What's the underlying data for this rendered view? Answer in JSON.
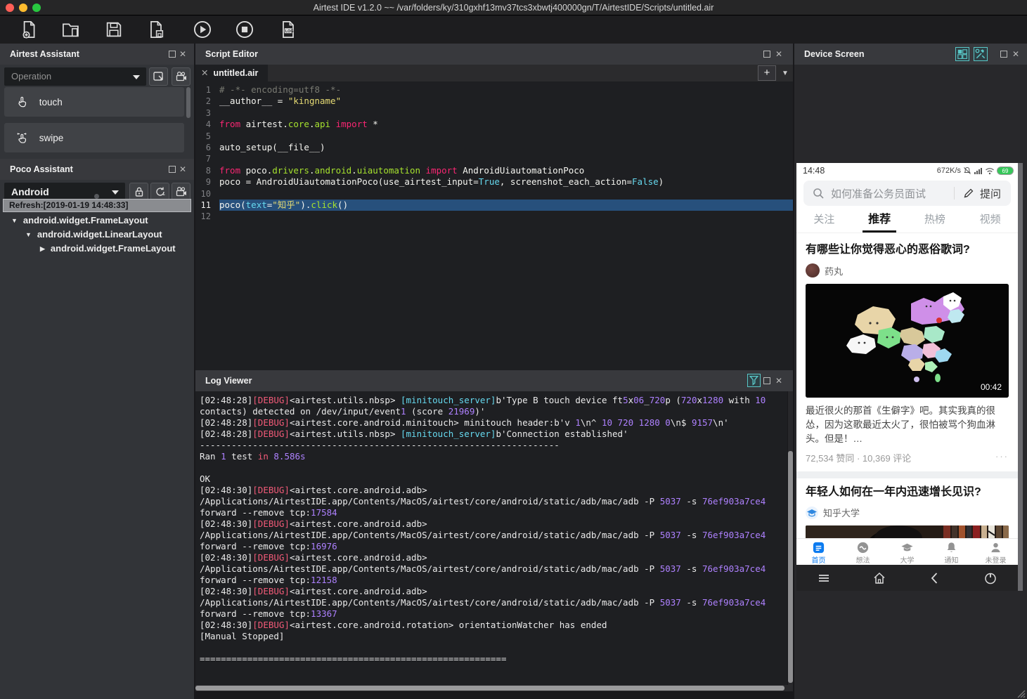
{
  "window": {
    "title": "Airtest IDE v1.2.0 ~~ /var/folders/ky/310gxhf13mv37tcs3xbwtj400000gn/T/AirtestIDE/Scripts/untitled.air"
  },
  "colors": {
    "accent_cyan": "#59c6c6",
    "highlight_line": "#27507c",
    "zhihu_blue": "#0c7bf0",
    "battery_green": "#35c759"
  },
  "toolbar": {
    "buttons": [
      "new-script",
      "open-script",
      "save-script",
      "save-script-as",
      "run-script",
      "stop-script",
      "view-log"
    ]
  },
  "airtest": {
    "title": "Airtest Assistant",
    "dropdown_value": "Operation",
    "actions": [
      {
        "label": "touch"
      },
      {
        "label": "swipe"
      }
    ]
  },
  "poco": {
    "title": "Poco Assistant",
    "dropdown_value": "Android",
    "refresh_label": "Refresh:[2019-01-19 14:48:33]",
    "tree": [
      {
        "arrow": "▼",
        "label": "android.widget.FrameLayout"
      },
      {
        "arrow": "▼",
        "label": "android.widget.LinearLayout"
      },
      {
        "arrow": "▶",
        "label": "android.widget.FrameLayout"
      }
    ]
  },
  "editor": {
    "title": "Script Editor",
    "tab": "untitled.air",
    "lines": [
      {
        "n": 1,
        "t": [
          [
            "cm",
            "# -*- encoding=utf8 -*-"
          ]
        ]
      },
      {
        "n": 2,
        "t": [
          [
            "p",
            "__author__ = "
          ],
          [
            "s",
            "\"kingname\""
          ]
        ]
      },
      {
        "n": 3,
        "t": []
      },
      {
        "n": 4,
        "t": [
          [
            "k",
            "from"
          ],
          [
            "p",
            " airtest."
          ],
          [
            "f",
            "core"
          ],
          [
            "p",
            "."
          ],
          [
            "f",
            "api"
          ],
          [
            "p",
            " "
          ],
          [
            "k",
            "import"
          ],
          [
            "p",
            " *"
          ]
        ]
      },
      {
        "n": 5,
        "t": []
      },
      {
        "n": 6,
        "t": [
          [
            "p",
            "auto_setup(__file__)"
          ]
        ]
      },
      {
        "n": 7,
        "t": []
      },
      {
        "n": 8,
        "t": [
          [
            "k",
            "from"
          ],
          [
            "p",
            " poco."
          ],
          [
            "f",
            "drivers"
          ],
          [
            "p",
            "."
          ],
          [
            "f",
            "android"
          ],
          [
            "p",
            "."
          ],
          [
            "f",
            "uiautomation"
          ],
          [
            "p",
            " "
          ],
          [
            "k",
            "import"
          ],
          [
            "p",
            " AndroidUiautomationPoco"
          ]
        ]
      },
      {
        "n": 9,
        "t": [
          [
            "p",
            "poco = AndroidUiautomationPoco(use_airtest_input="
          ],
          [
            "c",
            "True"
          ],
          [
            "p",
            ", screenshot_each_action="
          ],
          [
            "c",
            "False"
          ],
          [
            "p",
            ")"
          ]
        ]
      },
      {
        "n": 10,
        "t": []
      },
      {
        "n": 11,
        "hl": true,
        "t": [
          [
            "p",
            "poco("
          ],
          [
            "c",
            "text"
          ],
          [
            "p",
            "="
          ],
          [
            "s",
            "\"知乎\""
          ],
          [
            "p",
            ")."
          ],
          [
            "f",
            "click"
          ],
          [
            "p",
            "()"
          ]
        ]
      },
      {
        "n": 12,
        "t": []
      }
    ]
  },
  "logview": {
    "title": "Log Viewer",
    "lines": [
      [
        [
          "p",
          "[02:48:28]"
        ],
        [
          "d",
          "[DEBUG]"
        ],
        [
          "p",
          "<airtest.utils.nbsp> "
        ],
        [
          "c",
          "[minitouch_server]"
        ],
        [
          "p",
          "b'Type B touch device ft"
        ],
        [
          "n",
          "5"
        ],
        [
          "p",
          "x"
        ],
        [
          "n",
          "06"
        ],
        [
          "p",
          "_"
        ],
        [
          "n",
          "720"
        ],
        [
          "p",
          "p ("
        ],
        [
          "n",
          "720"
        ],
        [
          "p",
          "x"
        ],
        [
          "n",
          "1280"
        ],
        [
          "p",
          " with "
        ],
        [
          "n",
          "10"
        ]
      ],
      [
        [
          "p",
          "contacts) detected on /dev/input/event"
        ],
        [
          "n",
          "1"
        ],
        [
          "p",
          " (score "
        ],
        [
          "n",
          "21969"
        ],
        [
          "p",
          ")'"
        ]
      ],
      [
        [
          "p",
          "[02:48:28]"
        ],
        [
          "d",
          "[DEBUG]"
        ],
        [
          "p",
          "<airtest.core.android.minitouch> minitouch header:b'v "
        ],
        [
          "n",
          "1"
        ],
        [
          "p",
          "\\n^ "
        ],
        [
          "n",
          "10 720 1280 0"
        ],
        [
          "p",
          "\\n$ "
        ],
        [
          "n",
          "9157"
        ],
        [
          "p",
          "\\n'"
        ]
      ],
      [
        [
          "p",
          "[02:48:28]"
        ],
        [
          "d",
          "[DEBUG]"
        ],
        [
          "p",
          "<airtest.utils.nbsp> "
        ],
        [
          "c",
          "[minitouch_server]"
        ],
        [
          "p",
          "b'Connection established'"
        ]
      ],
      [
        [
          "p",
          "--------------------------------------------------------------------"
        ]
      ],
      [
        [
          "p",
          "Ran "
        ],
        [
          "n",
          "1"
        ],
        [
          "p",
          " test "
        ],
        [
          "d",
          "in"
        ],
        [
          "p",
          " "
        ],
        [
          "n",
          "8.586s"
        ]
      ],
      [],
      [
        [
          "p",
          "OK"
        ]
      ],
      [
        [
          "p",
          "[02:48:30]"
        ],
        [
          "d",
          "[DEBUG]"
        ],
        [
          "p",
          "<airtest.core.android.adb>"
        ]
      ],
      [
        [
          "p",
          "/Applications/AirtestIDE.app/Contents/MacOS/airtest/core/android/static/adb/mac/adb -P "
        ],
        [
          "n",
          "5037"
        ],
        [
          "p",
          " -s "
        ],
        [
          "n",
          "76ef903a7ce4"
        ]
      ],
      [
        [
          "p",
          "forward --remove tcp:"
        ],
        [
          "n",
          "17584"
        ]
      ],
      [
        [
          "p",
          "[02:48:30]"
        ],
        [
          "d",
          "[DEBUG]"
        ],
        [
          "p",
          "<airtest.core.android.adb>"
        ]
      ],
      [
        [
          "p",
          "/Applications/AirtestIDE.app/Contents/MacOS/airtest/core/android/static/adb/mac/adb -P "
        ],
        [
          "n",
          "5037"
        ],
        [
          "p",
          " -s "
        ],
        [
          "n",
          "76ef903a7ce4"
        ]
      ],
      [
        [
          "p",
          "forward --remove tcp:"
        ],
        [
          "n",
          "16976"
        ]
      ],
      [
        [
          "p",
          "[02:48:30]"
        ],
        [
          "d",
          "[DEBUG]"
        ],
        [
          "p",
          "<airtest.core.android.adb>"
        ]
      ],
      [
        [
          "p",
          "/Applications/AirtestIDE.app/Contents/MacOS/airtest/core/android/static/adb/mac/adb -P "
        ],
        [
          "n",
          "5037"
        ],
        [
          "p",
          " -s "
        ],
        [
          "n",
          "76ef903a7ce4"
        ]
      ],
      [
        [
          "p",
          "forward --remove tcp:"
        ],
        [
          "n",
          "12158"
        ]
      ],
      [
        [
          "p",
          "[02:48:30]"
        ],
        [
          "d",
          "[DEBUG]"
        ],
        [
          "p",
          "<airtest.core.android.adb>"
        ]
      ],
      [
        [
          "p",
          "/Applications/AirtestIDE.app/Contents/MacOS/airtest/core/android/static/adb/mac/adb -P "
        ],
        [
          "n",
          "5037"
        ],
        [
          "p",
          " -s "
        ],
        [
          "n",
          "76ef903a7ce4"
        ]
      ],
      [
        [
          "p",
          "forward --remove tcp:"
        ],
        [
          "n",
          "13367"
        ]
      ],
      [
        [
          "p",
          "[02:48:30]"
        ],
        [
          "d",
          "[DEBUG]"
        ],
        [
          "p",
          "<airtest.core.android.rotation> orientationWatcher has ended"
        ]
      ],
      [
        [
          "p",
          "[Manual Stopped]"
        ]
      ],
      [],
      [
        [
          "p",
          "=========================================================="
        ]
      ]
    ]
  },
  "device": {
    "title": "Device Screen",
    "phone": {
      "time": "14:48",
      "net_speed": "672K/s",
      "battery": "69",
      "search_placeholder": "如何准备公务员面试",
      "ask_label": "提问",
      "tabs": [
        {
          "label": "关注",
          "active": false
        },
        {
          "label": "推荐",
          "active": true
        },
        {
          "label": "热榜",
          "active": false
        },
        {
          "label": "视频",
          "active": false
        }
      ],
      "feed": [
        {
          "title": "有哪些让你觉得恶心的恶俗歌词?",
          "author": "药丸",
          "video_duration": "00:42",
          "excerpt": "最近很火的那首《生僻字》吧。其实我真的很怂，因为这歌最近太火了，很怕被骂个狗血淋头。但是！…",
          "stats": "72,534 赞同 · 10,369 评论",
          "more": "···"
        },
        {
          "title": "年轻人如何在一年内迅速增长见识?",
          "author": "知乎大学"
        }
      ],
      "nav": [
        {
          "label": "首页",
          "active": true
        },
        {
          "label": "想法",
          "active": false
        },
        {
          "label": "大学",
          "active": false
        },
        {
          "label": "通知",
          "active": false
        },
        {
          "label": "未登录",
          "active": false
        }
      ]
    }
  }
}
